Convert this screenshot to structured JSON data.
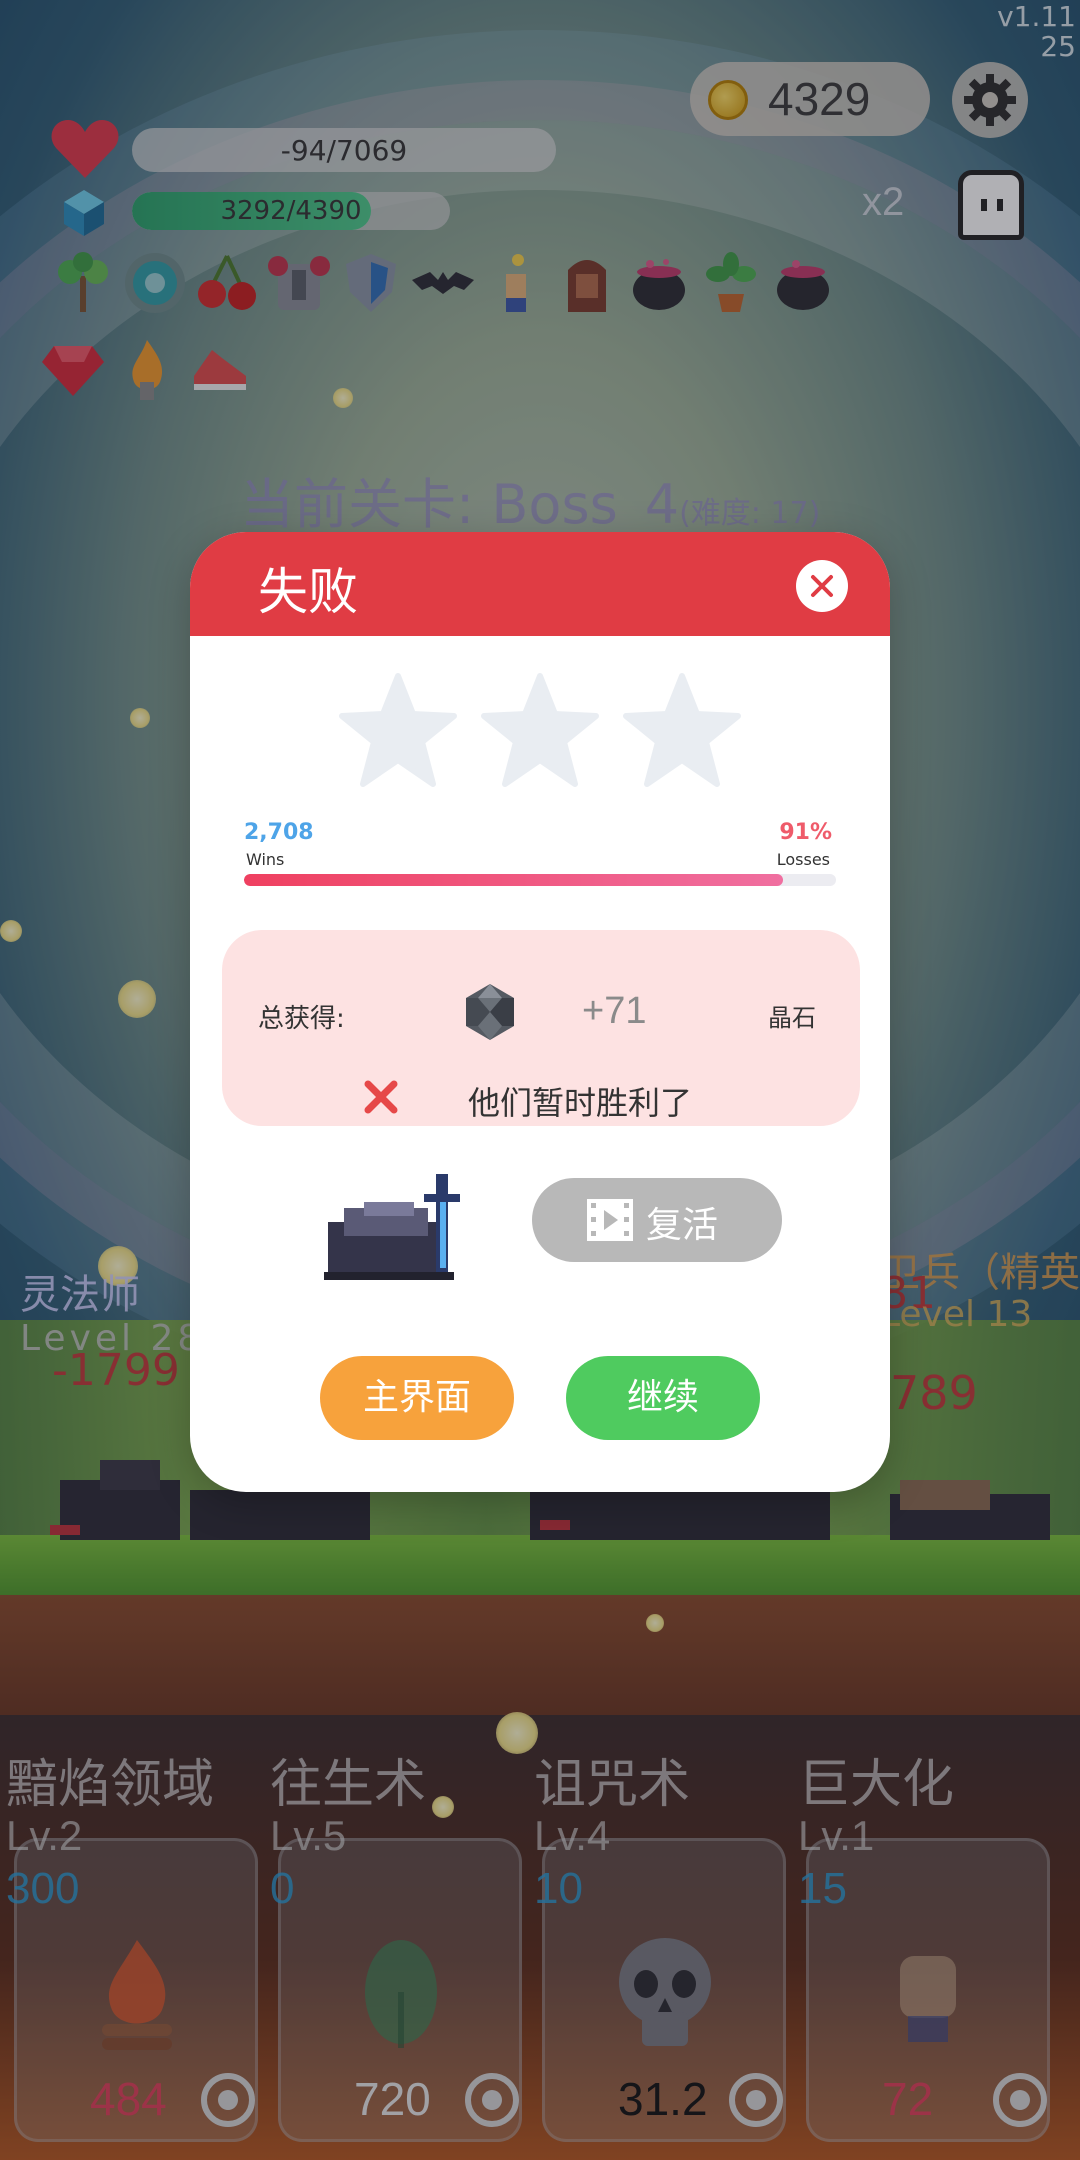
{
  "version": "v1.11\n25",
  "version_line1": "v1.11",
  "version_line2": "25",
  "currency": {
    "coins": "4329",
    "icon": "gold-coin-icon"
  },
  "settings_icon": "gear-icon",
  "speed_multiplier": "x2",
  "player": {
    "hp_text": "-94/7069",
    "xp_text": "3292/4390",
    "xp_progress": 0.75
  },
  "items": [
    "sapling-icon",
    "target-icon",
    "cherry-icon",
    "armor-icon",
    "shield-icon",
    "bat-icon",
    "torch-hand-icon",
    "door-icon",
    "cauldron-icon",
    "potted-plant-icon",
    "cauldron-icon",
    "ruby-icon",
    "flame-icon",
    "sneaker-icon"
  ],
  "stage": {
    "title": "当前关卡: Boss_4",
    "difficulty": "(难度: 17)"
  },
  "battle_text": {
    "left_name": "灵法师",
    "left_level": "Level 28",
    "left_damage": "-1799",
    "right_name": "卫兵（精英",
    "right_level": "Level 13",
    "right_damage_top": "81",
    "right_damage_bottom": "789"
  },
  "skills": [
    {
      "name": "黯焰领域",
      "level": "Lv.2",
      "cost": "300",
      "cooldown": "484",
      "cooldown_color": "#e0405a",
      "icon": "campfire-icon"
    },
    {
      "name": "往生术",
      "level": "Lv.5",
      "cost": "0",
      "cooldown": "720",
      "cooldown_color": "#e9e9e9",
      "icon": "leaf-icon"
    },
    {
      "name": "诅咒术",
      "level": "Lv.4",
      "cost": "10",
      "cooldown": "31.2",
      "cooldown_color": "#111111",
      "icon": "skull-icon"
    },
    {
      "name": "巨大化",
      "level": "Lv.1",
      "cost": "15",
      "cooldown": "72",
      "cooldown_color": "#e0405a",
      "icon": "fist-icon"
    }
  ],
  "dialog": {
    "title": "失败",
    "stars_earned": 0,
    "stars_total": 3,
    "wins_count": "2,708",
    "wins_label": "Wins",
    "loss_percent": "91%",
    "loss_label": "Losses",
    "loss_ratio": 0.91,
    "reward_label": "总获得:",
    "reward_amount": "+71",
    "reward_unit": "晶石",
    "reward_icon": "crystal-gem-icon",
    "defeat_message": "他们暂时胜利了",
    "revive_label": "复活",
    "home_label": "主界面",
    "continue_label": "继续"
  },
  "colors": {
    "header_red": "#e03c44",
    "reward_bg": "#fde2e2",
    "home_orange": "#f7a23c",
    "continue_green": "#4fcb5f",
    "revive_gray": "#b8b8b8",
    "wins_blue": "#4ea4e8",
    "losses_red": "#ef5b6a"
  }
}
